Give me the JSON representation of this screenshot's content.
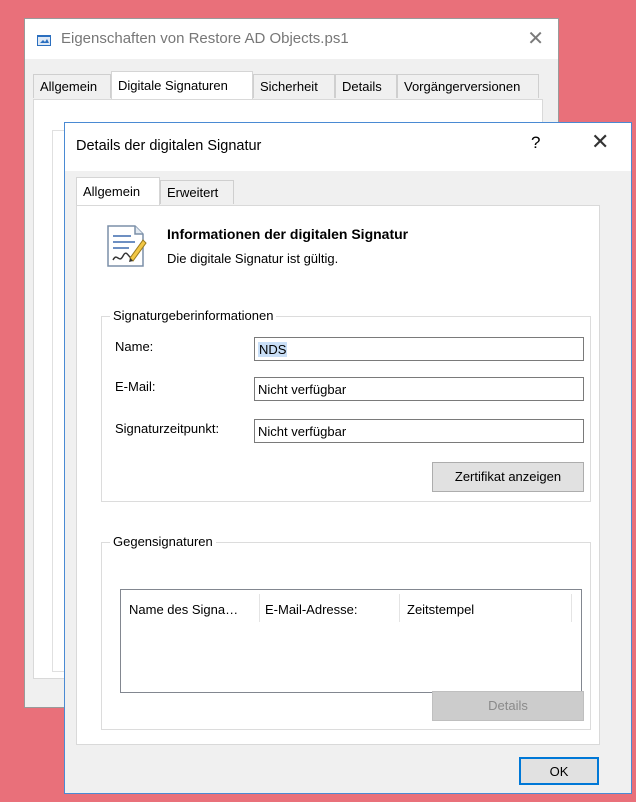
{
  "back_window": {
    "title": "Eigenschaften von Restore AD Objects.ps1",
    "tabs": [
      "Allgemein",
      "Digitale Signaturen",
      "Sicherheit",
      "Details",
      "Vorgängerversionen"
    ],
    "active_tab": "Digitale Signaturen",
    "icons": {
      "file": "ps1-file-icon",
      "close": "close-icon"
    }
  },
  "dialog": {
    "title": "Details der digitalen Signatur",
    "help_symbol": "?",
    "close_symbol": "✕",
    "tabs": [
      "Allgemein",
      "Erweitert"
    ],
    "active_tab": "Allgemein",
    "info_title": "Informationen der digitalen Signatur",
    "info_status": "Die digitale Signatur ist gültig.",
    "signer_group": {
      "label": "Signaturgeberinformationen",
      "name_label": "Name:",
      "name_value": "NDS",
      "email_label": "E-Mail:",
      "email_value": "Nicht verfügbar",
      "time_label": "Signaturzeitpunkt:",
      "time_value": "Nicht verfügbar",
      "cert_button": "Zertifikat anzeigen"
    },
    "countersig_group": {
      "label": "Gegensignaturen",
      "columns": [
        "Name des Signa…",
        "E-Mail-Adresse:",
        "Zeitstempel"
      ],
      "details_button": "Details"
    },
    "ok_button": "OK"
  }
}
